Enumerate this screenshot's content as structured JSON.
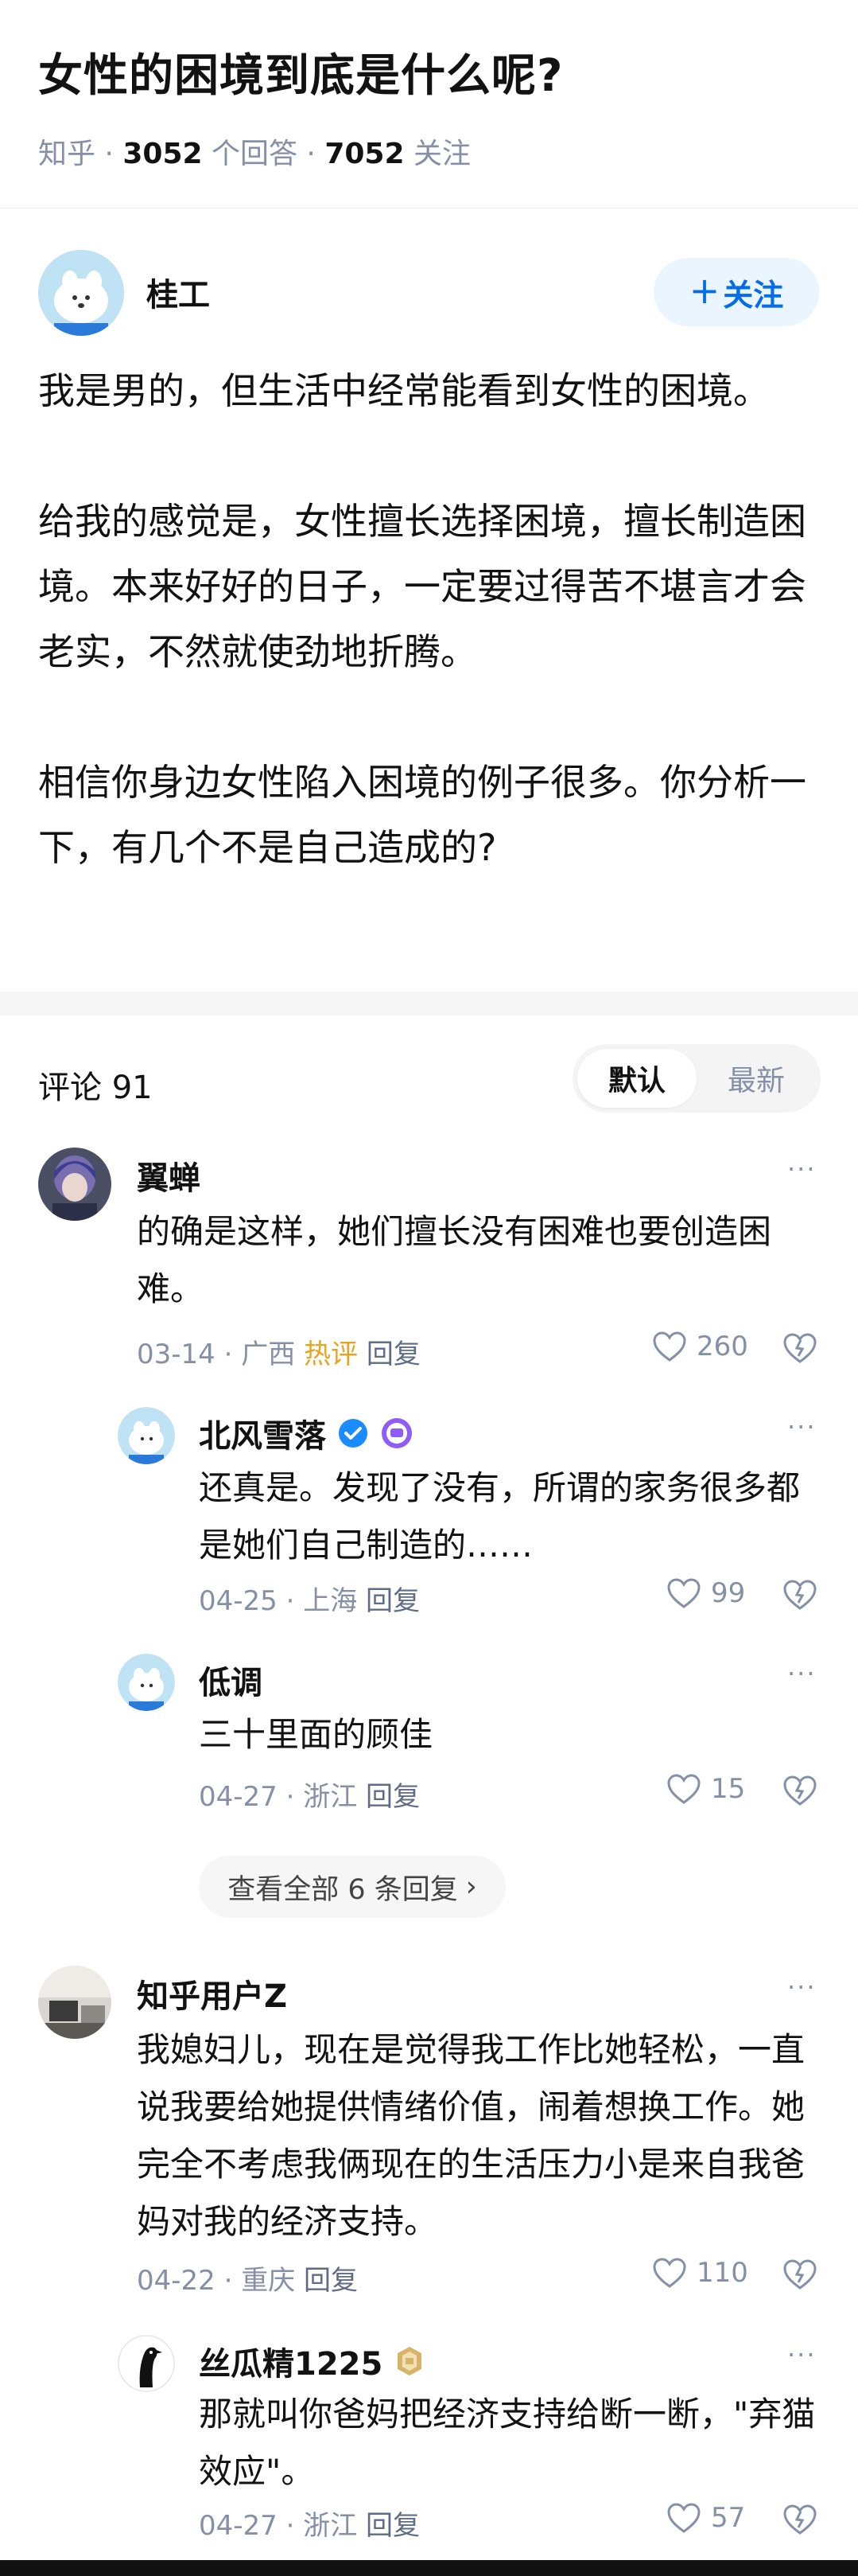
{
  "question": {
    "title": "女性的困境到底是什么呢?",
    "source": "知乎 · ",
    "answer_count": "3052",
    "answer_label": " 个回答 · ",
    "follow_count": "7052",
    "follow_label": " 关注"
  },
  "author": {
    "name": "桂工",
    "follow_plus": "+",
    "follow_label": "关注"
  },
  "answer": {
    "paragraphs": [
      "我是男的，但生活中经常能看到女性的困境。",
      "给我的感觉是，女性擅长选择困境，擅长制造困境。本来好好的日子，一定要过得苦不堪言才会老实，不然就使劲地折腾。",
      "相信你身边女性陷入困境的例子很多。你分析一下，有几个不是自己造成的?"
    ]
  },
  "comments_header": {
    "label": "评论 91",
    "sort_default": "默认",
    "sort_latest": "最新"
  },
  "comments": [
    {
      "name": "翼蝉",
      "text": "的确是这样，她们擅长没有困难也要创造困难。",
      "date": "03-14 · 广西 ",
      "hot": "热评",
      "reply": "回复",
      "likes": "260"
    },
    {
      "name": "北风雪落",
      "text": "还真是。发现了没有，所谓的家务很多都是她们自己制造的……",
      "date": "04-25 · 上海 ",
      "reply": "回复",
      "likes": "99"
    },
    {
      "name": "低调",
      "text": "三十里面的顾佳",
      "date": "04-27 · 浙江 ",
      "reply": "回复",
      "likes": "15"
    },
    {
      "name": "知乎用户Z",
      "text": "我媳妇儿，现在是觉得我工作比她轻松，一直说我要给她提供情绪价值，闹着想换工作。她完全不考虑我俩现在的生活压力小是来自我爸妈对我的经济支持。",
      "date": "04-22 · 重庆 ",
      "reply": "回复",
      "likes": "110"
    },
    {
      "name": "丝瓜精1225",
      "text": "那就叫你爸妈把经济支持给断一断，\"弃猫效应\"。",
      "date": "04-27 · 浙江 ",
      "reply": "回复",
      "likes": "57"
    }
  ],
  "see_all": {
    "label": "查看全部 6 条回复",
    "chevron": "›"
  },
  "more_glyph": "···",
  "colors": {
    "brand_blue": "#056de8",
    "meta_gray": "#8590a6",
    "hot_yellow": "#e7a51f",
    "verified_blue": "#1a8cff"
  },
  "icons": [
    "more-icon",
    "heart-icon",
    "dislike-icon",
    "verified-icon",
    "badge-icon",
    "chevron-right-icon"
  ]
}
